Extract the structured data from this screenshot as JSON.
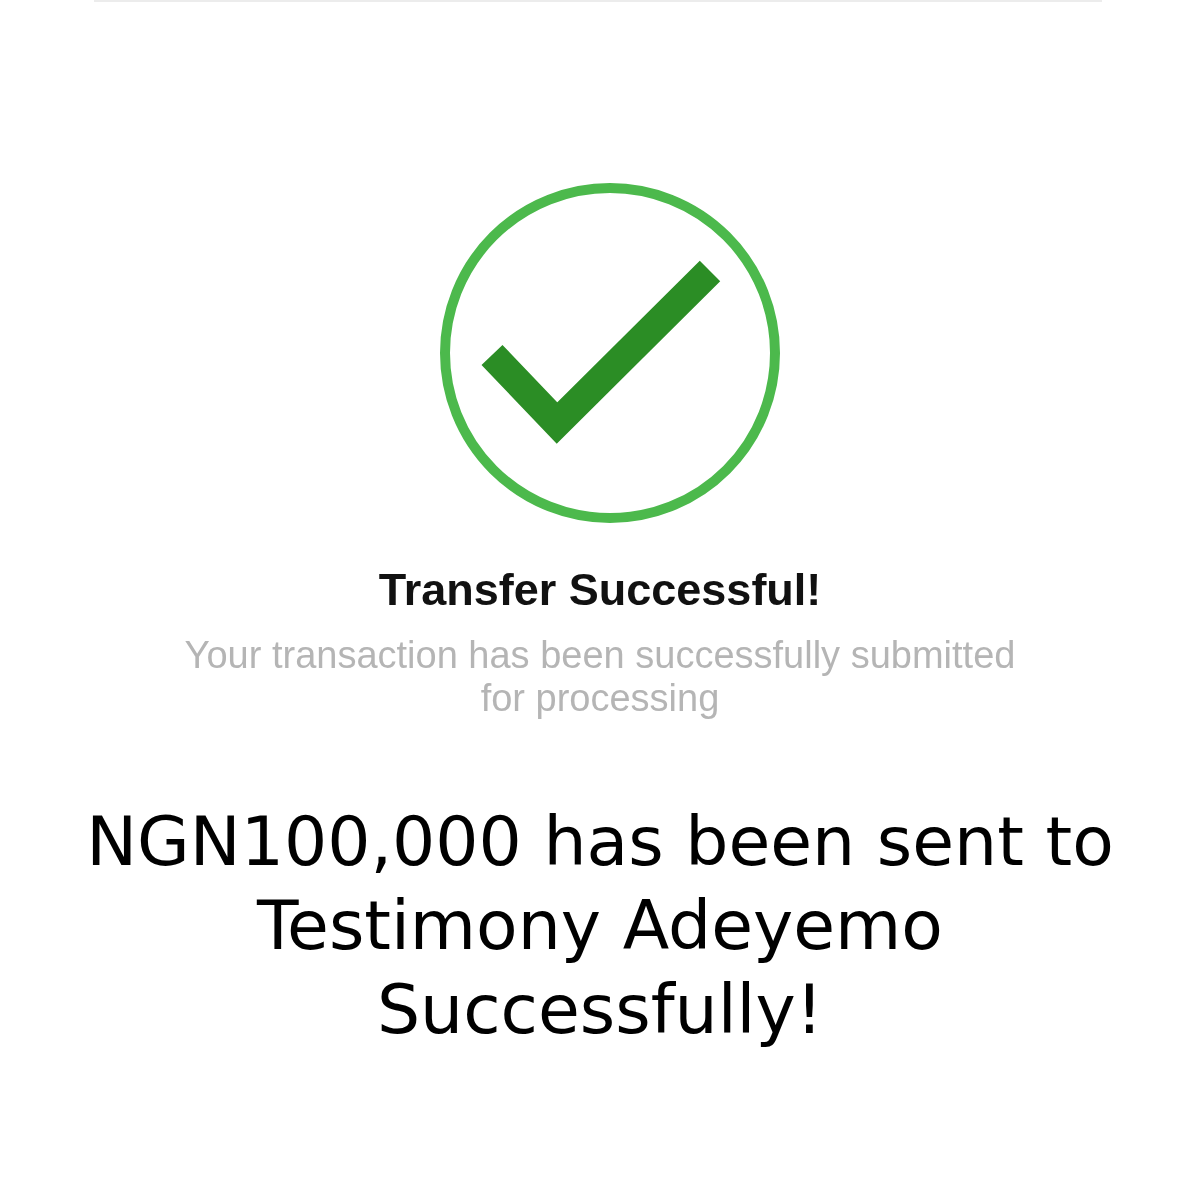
{
  "title": "Transfer Successful!",
  "subtitle": "Your transaction has been successfully submitted for processing",
  "message_lines": [
    "NGN100,000 has been sent to",
    "Testimony Adeyemo",
    "Successfully!"
  ]
}
